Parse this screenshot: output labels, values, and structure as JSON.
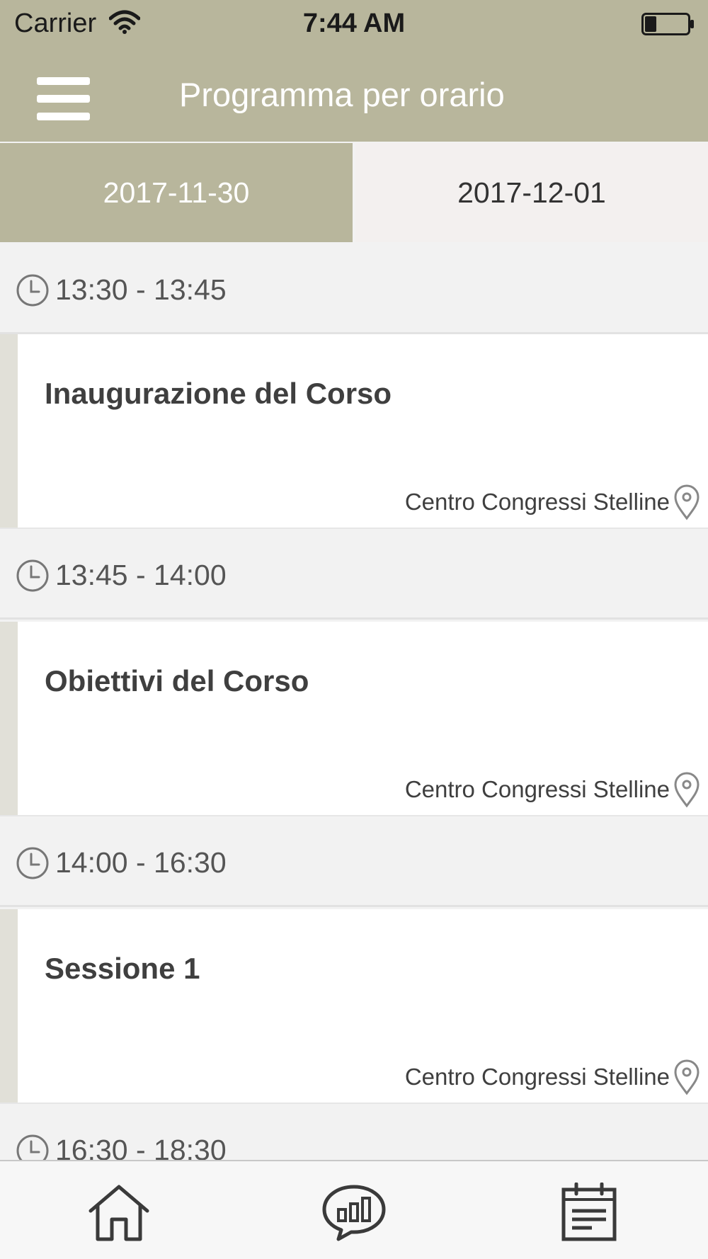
{
  "status_bar": {
    "carrier": "Carrier",
    "time": "7:44 AM"
  },
  "nav": {
    "title": "Programma per orario",
    "menu_icon": "hamburger-menu-icon"
  },
  "tabs": [
    {
      "label": "2017-11-30",
      "active": true
    },
    {
      "label": "2017-12-01",
      "active": false
    }
  ],
  "schedule": [
    {
      "time": "13:30 - 13:45",
      "title": "Inaugurazione del Corso",
      "location": "Centro Congressi Stelline"
    },
    {
      "time": "13:45 - 14:00",
      "title": "Obiettivi del Corso",
      "location": "Centro Congressi Stelline"
    },
    {
      "time": "14:00 - 16:30",
      "title": "Sessione 1",
      "location": "Centro Congressi Stelline"
    },
    {
      "time": "16:30 - 18:30"
    }
  ],
  "bottom_nav": [
    {
      "icon": "home-icon"
    },
    {
      "icon": "chat-stats-icon"
    },
    {
      "icon": "calendar-icon"
    }
  ],
  "colors": {
    "accent": "#b8b69c",
    "inactive_tab": "#f3f0ef",
    "section_bg": "#f2f2f2",
    "card_accent": "#e1e0d8"
  }
}
